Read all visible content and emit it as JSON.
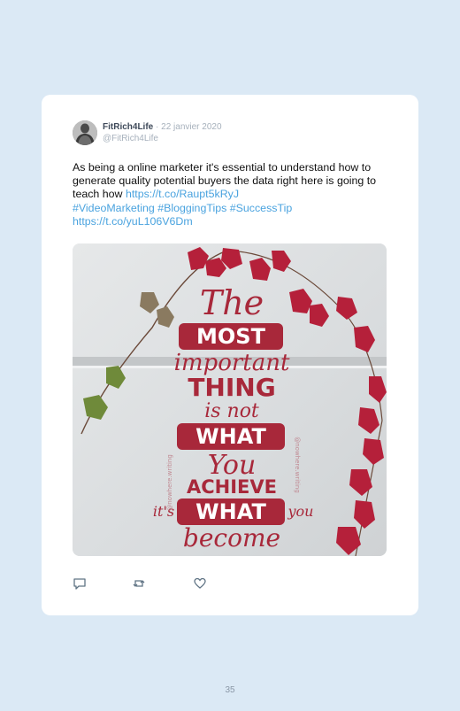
{
  "tweet": {
    "author_name": "FitRich4Life",
    "separator": "·",
    "date": "22 janvier 2020",
    "handle": "@FitRich4Life",
    "text": "As being a online marketer it's essential to understand how to generate quality potential buyers the data right here is going to teach how",
    "link1": "https://t.co/Raupt5kRyJ",
    "hashtags": [
      "#VideoMarketing",
      "#BloggingTips",
      "#SuccessTip"
    ],
    "link2": "https://t.co/yuL106V6Dm"
  },
  "image": {
    "quote_lines": [
      "The",
      "MOST",
      "important",
      "THING",
      "is not",
      "WHAT",
      "You",
      "ACHIEVE",
      "it's",
      "WHAT",
      "you",
      "become"
    ],
    "watermark": "@nowhere.writing"
  },
  "actions": {
    "reply_icon": "reply-icon",
    "retweet_icon": "retweet-icon",
    "like_icon": "heart-icon"
  },
  "page": {
    "number": "35"
  },
  "colors": {
    "background": "#dbe9f5",
    "card": "#ffffff",
    "link": "#4aa3df",
    "quote": "#a8283a",
    "leaf": "#b5203a"
  }
}
